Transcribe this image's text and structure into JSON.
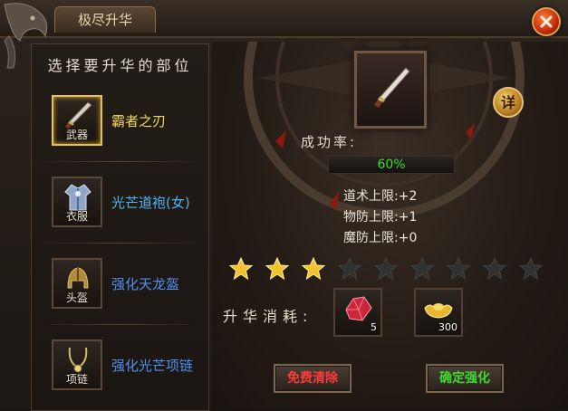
{
  "window": {
    "title": "极尽升华"
  },
  "left_panel": {
    "header": "选择要升华的部位",
    "slots": [
      {
        "slot_label": "武器",
        "item_name": "霸者之刃",
        "name_color": "#f2d95a",
        "selected": true
      },
      {
        "slot_label": "衣服",
        "item_name": "光芒道袍(女)",
        "name_color": "#4fb3f0",
        "selected": false
      },
      {
        "slot_label": "头盔",
        "item_name": "强化天龙盔",
        "name_color": "#4f8ff0",
        "selected": false
      },
      {
        "slot_label": "项链",
        "item_name": "强化光芒项链",
        "name_color": "#4f8ff0",
        "selected": false
      }
    ]
  },
  "main": {
    "details_label": "详",
    "success_rate_label": "成功率:",
    "success_rate_value": "60%",
    "stats": [
      "道术上限:+2",
      "物防上限:+1",
      "魔防上限:+0"
    ],
    "stars": {
      "filled": 3,
      "total": 9
    },
    "cost_label": "升华消耗:",
    "costs": [
      {
        "item": "red-crystal",
        "count": "5"
      },
      {
        "item": "gold-ingot",
        "count": "300"
      }
    ],
    "buttons": {
      "free_clear": "免费清除",
      "confirm": "确定强化"
    }
  },
  "colors": {
    "accent_gold": "#e6c15a",
    "success_green": "#3cdc2c",
    "clear_red": "#ff3a3a",
    "confirm_green": "#3cdc2c"
  }
}
